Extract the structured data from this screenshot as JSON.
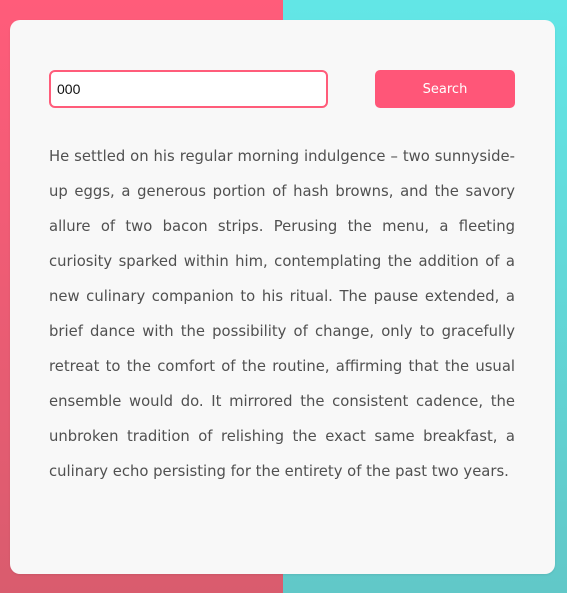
{
  "search": {
    "value": "000",
    "button_label": "Search"
  },
  "content": {
    "paragraph": "He settled on his regular morning indulgence – two sunnyside-up eggs, a generous portion of hash browns, and the savory allure of two bacon strips. Perusing the menu, a fleeting curiosity sparked within him, contemplating the addition of a new culinary companion to his ritual. The pause extended, a brief dance with the possibility of change, only to gracefully retreat to the comfort of the routine, affirming that the usual ensemble would do. It mirrored the consistent cadence, the unbroken tradition of relishing the exact same breakfast, a culinary echo persisting for the entirety of the past two years."
  },
  "colors": {
    "accent": "#ff5678",
    "background_left": "#ff5c7a",
    "background_right": "#62e3e3",
    "card": "#f8f8f8",
    "text": "#505050"
  }
}
